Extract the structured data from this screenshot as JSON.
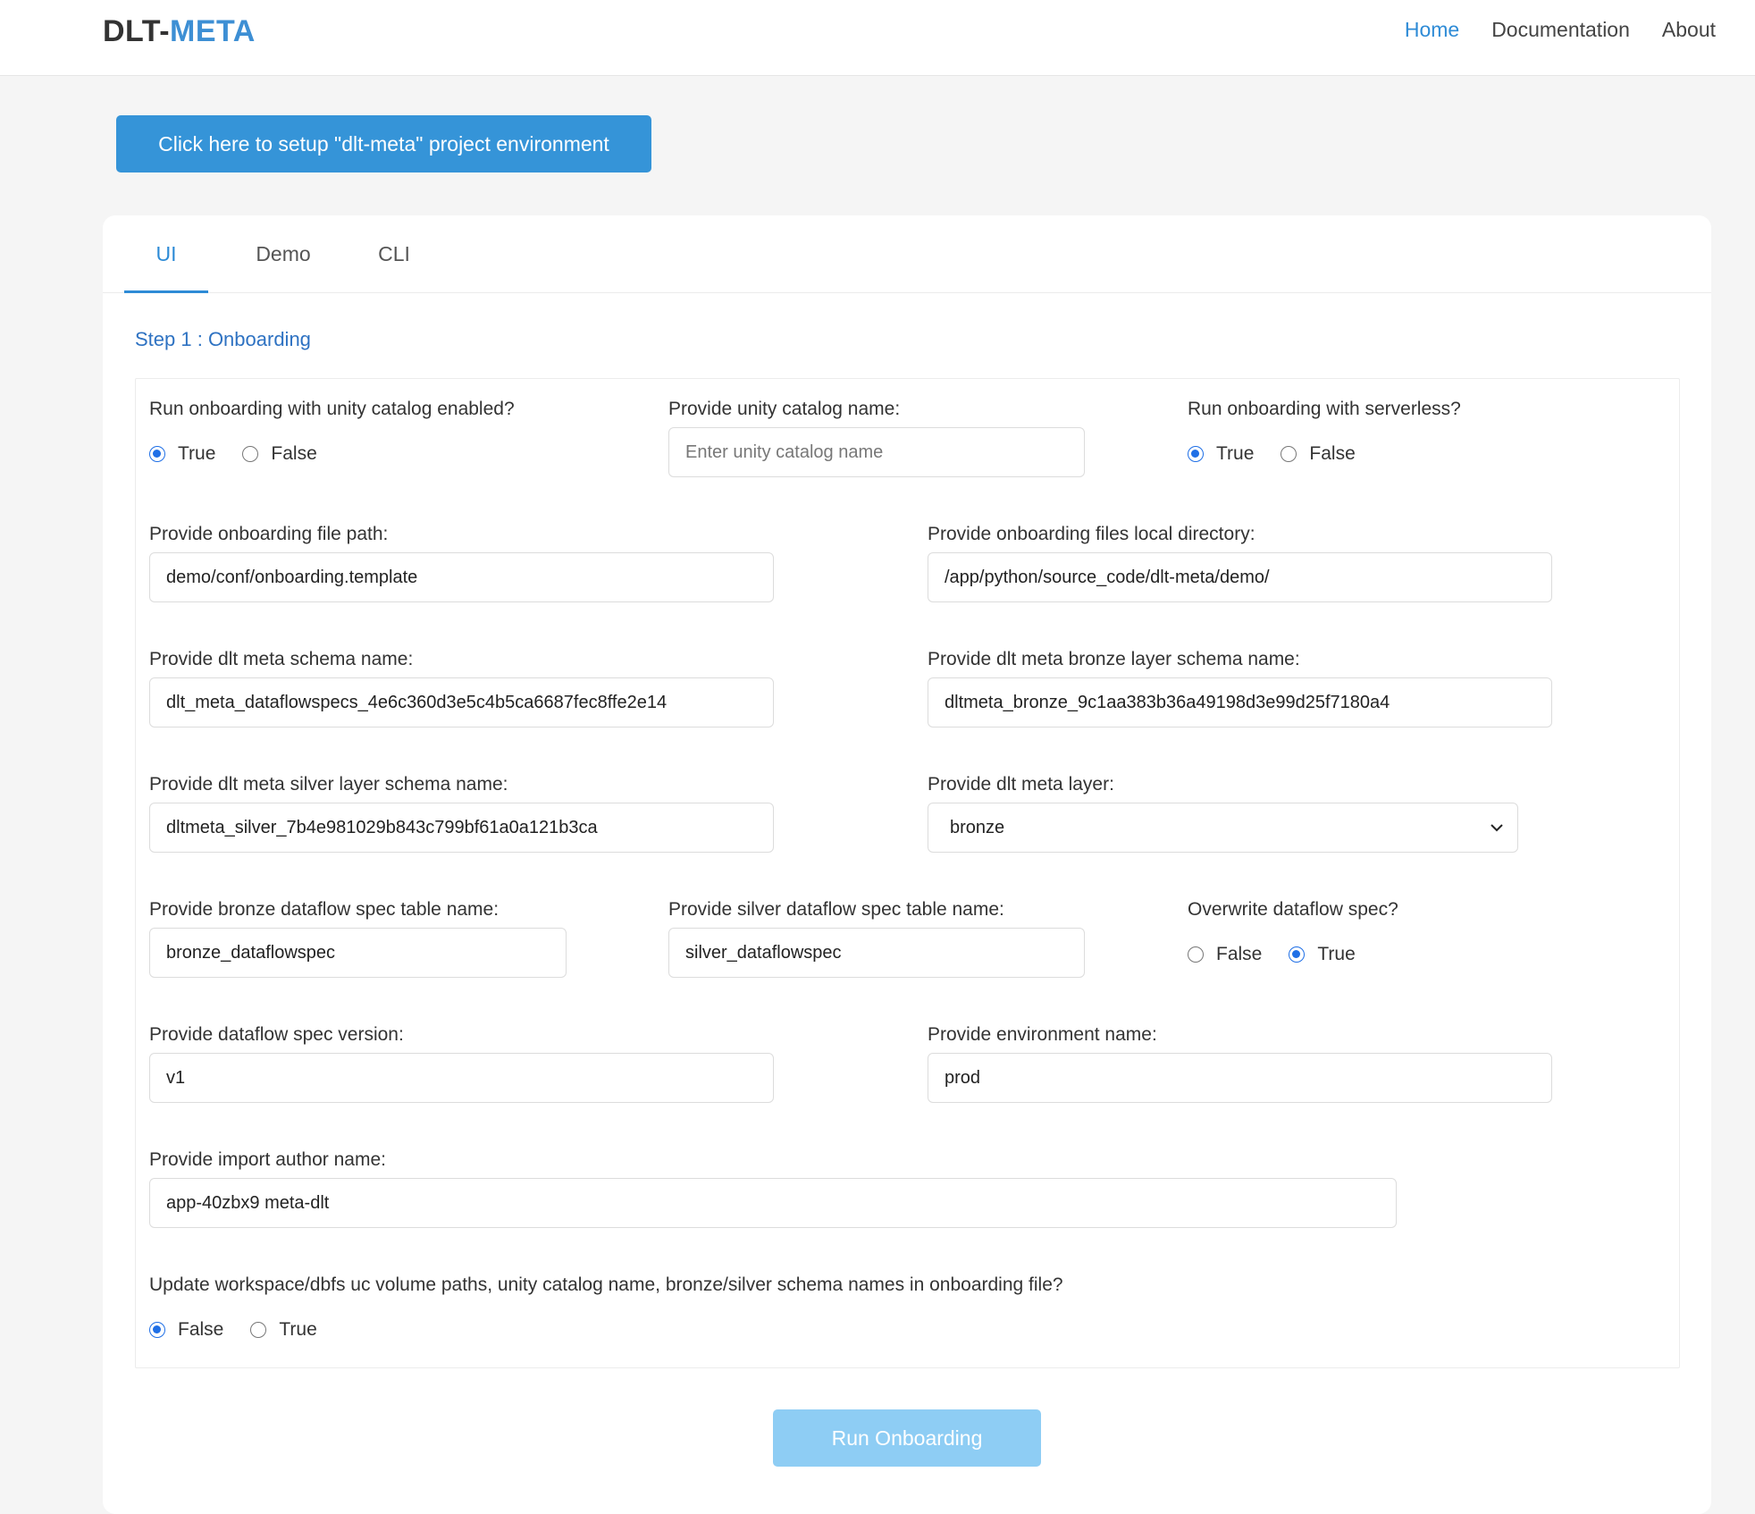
{
  "header": {
    "brand_part1": "DLT-",
    "brand_part2": "META",
    "nav": [
      {
        "label": "Home",
        "active": true
      },
      {
        "label": "Documentation",
        "active": false
      },
      {
        "label": "About",
        "active": false
      }
    ],
    "accent_color": "#2e8bd6"
  },
  "setup_button": "Click here to setup \"dlt-meta\" project environment",
  "tabs": [
    {
      "label": "UI",
      "active": true
    },
    {
      "label": "Demo",
      "active": false
    },
    {
      "label": "CLI",
      "active": false
    }
  ],
  "step_title": "Step 1 : Onboarding",
  "form": {
    "uc_enabled": {
      "label": "Run onboarding with unity catalog enabled?",
      "options": [
        "True",
        "False"
      ],
      "selected": "True"
    },
    "uc_name": {
      "label": "Provide unity catalog name:",
      "value": "",
      "placeholder": "Enter unity catalog name"
    },
    "serverless": {
      "label": "Run onboarding with serverless?",
      "options": [
        "True",
        "False"
      ],
      "selected": "True"
    },
    "onboarding_file_path": {
      "label": "Provide onboarding file path:",
      "value": "demo/conf/onboarding.template"
    },
    "local_directory": {
      "label": "Provide onboarding files local directory:",
      "value": "/app/python/source_code/dlt-meta/demo/"
    },
    "schema_name": {
      "label": "Provide dlt meta schema name:",
      "value": "dlt_meta_dataflowspecs_4e6c360d3e5c4b5ca6687fec8ffe2e14"
    },
    "bronze_schema": {
      "label": "Provide dlt meta bronze layer schema name:",
      "value": "dltmeta_bronze_9c1aa383b36a49198d3e99d25f7180a4"
    },
    "silver_schema": {
      "label": "Provide dlt meta silver layer schema name:",
      "value": "dltmeta_silver_7b4e981029b843c799bf61a0a121b3ca"
    },
    "layer": {
      "label": "Provide dlt meta layer:",
      "selected": "bronze"
    },
    "bronze_table": {
      "label": "Provide bronze dataflow spec table name:",
      "value": "bronze_dataflowspec"
    },
    "silver_table": {
      "label": "Provide silver dataflow spec table name:",
      "value": "silver_dataflowspec"
    },
    "overwrite": {
      "label": "Overwrite dataflow spec?",
      "options": [
        "False",
        "True"
      ],
      "selected": "True"
    },
    "spec_version": {
      "label": "Provide dataflow spec version:",
      "value": "v1"
    },
    "env_name": {
      "label": "Provide environment name:",
      "value": "prod"
    },
    "author": {
      "label": "Provide import author name:",
      "value": "app-40zbx9 meta-dlt"
    },
    "update_paths": {
      "label": "Update workspace/dbfs uc volume paths, unity catalog name, bronze/silver schema names in onboarding file?",
      "options": [
        "False",
        "True"
      ],
      "selected": "False"
    }
  },
  "run_button": "Run Onboarding"
}
